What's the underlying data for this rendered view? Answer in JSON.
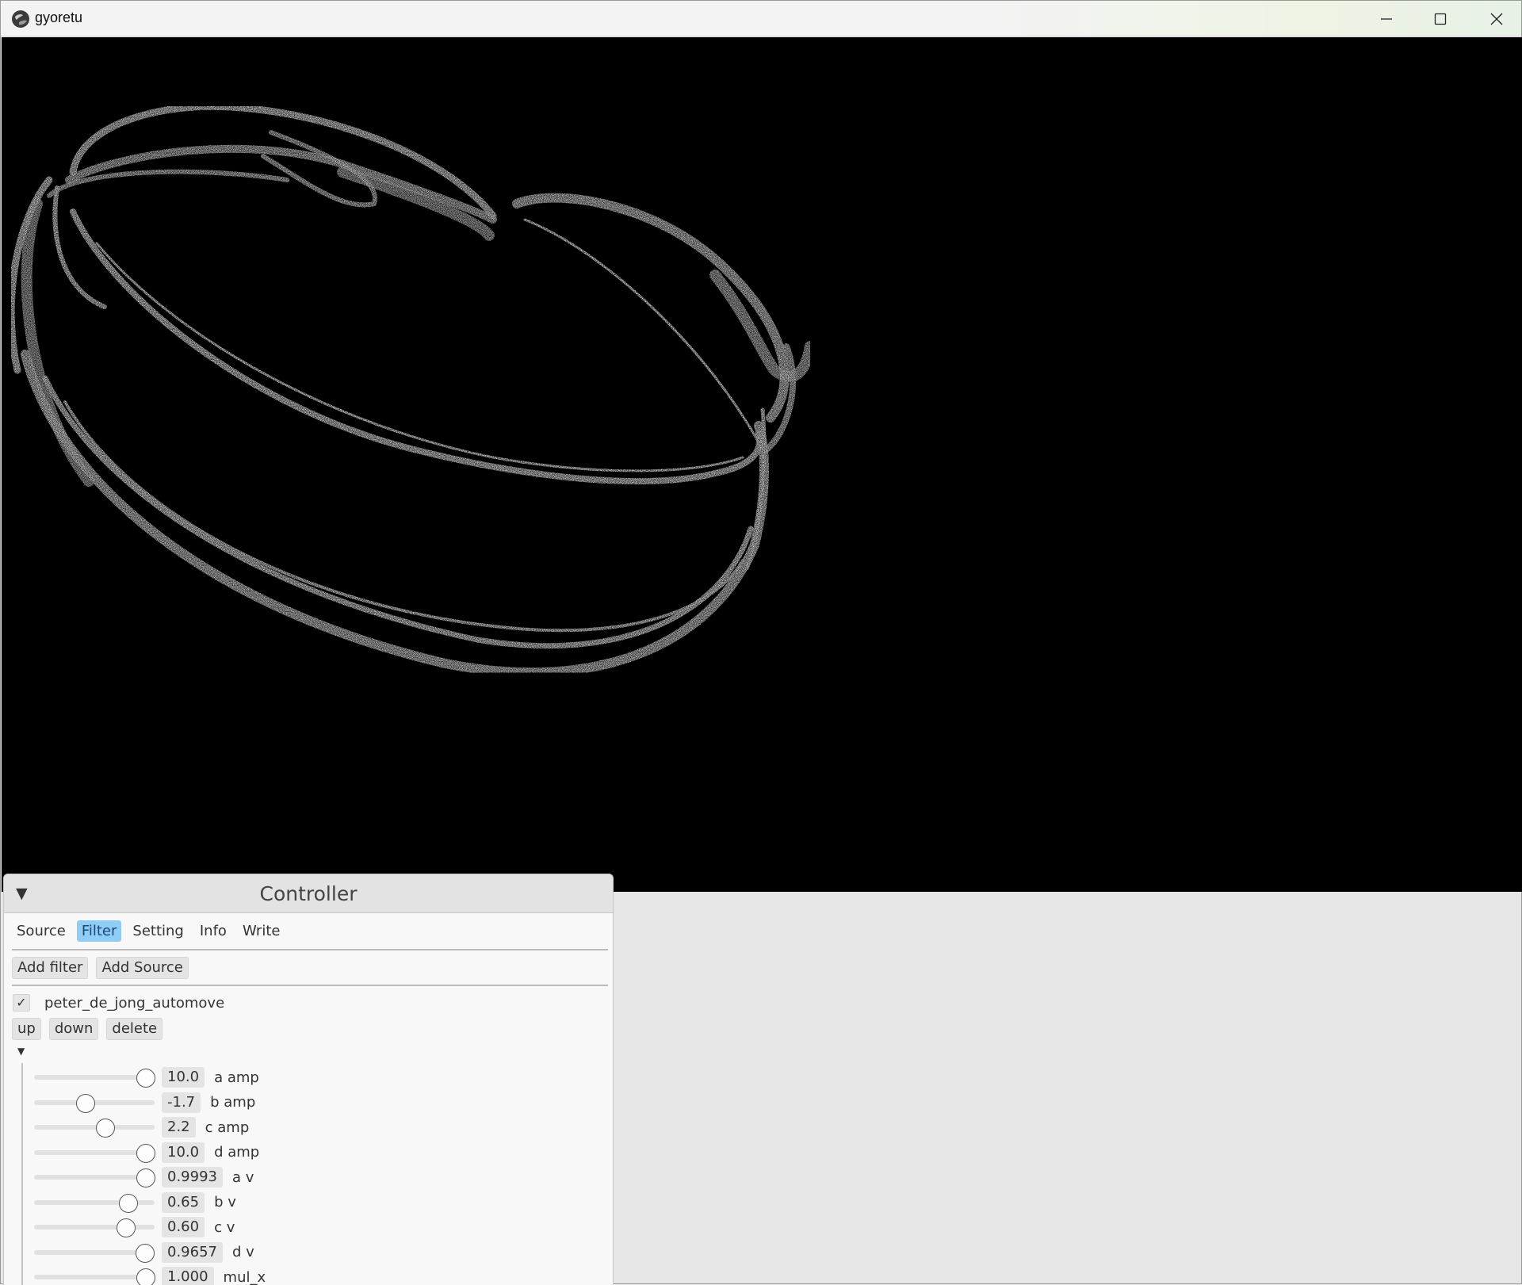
{
  "window": {
    "title": "gyoretu"
  },
  "controller": {
    "title": "Controller",
    "tabs": [
      {
        "label": "Source",
        "active": false
      },
      {
        "label": "Filter",
        "active": true
      },
      {
        "label": "Setting",
        "active": false
      },
      {
        "label": "Info",
        "active": false
      },
      {
        "label": "Write",
        "active": false
      }
    ],
    "add_filter_label": "Add filter",
    "add_source_label": "Add Source",
    "filter": {
      "checked": true,
      "check_glyph": "✓",
      "name": "peter_de_jong_automove",
      "up_label": "up",
      "down_label": "down",
      "delete_label": "delete"
    },
    "params": [
      {
        "label": "a amp",
        "value": "10.0",
        "level": 0.93
      },
      {
        "label": "b amp",
        "value": "-1.7",
        "level": 0.43
      },
      {
        "label": "c amp",
        "value": "2.2",
        "level": 0.59
      },
      {
        "label": "d amp",
        "value": "10.0",
        "level": 0.93
      },
      {
        "label": "a v",
        "value": "0.9993",
        "level": 0.93
      },
      {
        "label": "b v",
        "value": "0.65",
        "level": 0.78
      },
      {
        "label": "c v",
        "value": "0.60",
        "level": 0.76
      },
      {
        "label": "d v",
        "value": "0.9657",
        "level": 0.92
      },
      {
        "label": "mul_x",
        "value": "1.000",
        "level": 0.93
      }
    ]
  }
}
